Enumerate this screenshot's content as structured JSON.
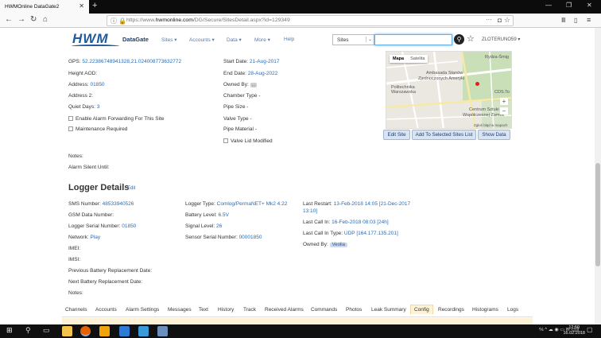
{
  "browser": {
    "tab_title": "HWMOnline DataGate2",
    "url_prefix": "https://www.",
    "url_domain": "hwmonline.com",
    "url_path": "/DG/Secure/SitesDetail.aspx?id=129349"
  },
  "header": {
    "logo": "HWM",
    "brand": "DataGate",
    "menu": [
      "Sites ▾",
      "Accounts ▾",
      "Data ▾",
      "More ▾",
      "Help"
    ],
    "sites_select": "Sites",
    "user": "ZLOTERUNO59 ▾"
  },
  "site": {
    "gps_label": "GPS:",
    "gps_value": "52.22386748941328,21.024008773632772",
    "height_label": "Height AOD:",
    "address_label": "Address:",
    "address_value": "01850",
    "address2_label": "Address 2:",
    "quiet_days_label": "Quiet Days:",
    "quiet_days_value": "3",
    "alarm_forwarding_label": "Enable Alarm Forwarding For This Site",
    "maintenance_label": "Maintenance Required",
    "start_date_label": "Start Date:",
    "start_date_value": "21-Aug-2017",
    "end_date_label": "End Date:",
    "end_date_value": "28-Aug-2022",
    "owned_by_label": "Owned By:",
    "owned_by_value": "...",
    "chamber_type_label": "Chamber Type -",
    "pipe_size_label": "Pipe Size -",
    "valve_type_label": "Valve Type -",
    "pipe_material_label": "Pipe Material -",
    "valve_lid_label": "Valve Lid Modified",
    "notes_label": "Notes:",
    "alarm_silent_label": "Alarm Silent Until:"
  },
  "map": {
    "tab_map": "Mapa",
    "tab_satellite": "Satelita",
    "labels": [
      "Rydza-Śmig",
      "Ambasada Stanów",
      "Zjednoczonych Ameryki",
      "Politechnika",
      "Warszawska",
      "Centrum Sztuki",
      "Współczesnej Zamek",
      "CDS.To",
      "Zgłoś błąd w mapach"
    ],
    "zoom_in": "+",
    "zoom_out": "−"
  },
  "map_buttons": {
    "edit_site": "Edit Site",
    "add_to_selected": "Add To Selected Sites List",
    "show_data": "Show Data"
  },
  "logger": {
    "title": "Logger Details",
    "edit": "Edit",
    "sms_label": "SMS Number:",
    "sms_value": "48533940526",
    "gsm_label": "GSM Data Number:",
    "serial_label": "Logger Serial Number:",
    "serial_value": "01850",
    "network_label": "Network:",
    "network_value": "Play",
    "imei_label": "IMEI:",
    "imsi_label": "IMSI:",
    "prev_battery_label": "Previous Battery Replacement Date:",
    "next_battery_label": "Next Battery Replacement Date:",
    "notes_label": "Notes:",
    "type_label": "Logger Type:",
    "type_value": "Comlog/PermaNET+ Mk2 4.22",
    "battery_label": "Battery Level:",
    "battery_value": "6.5V",
    "signal_label": "Signal Level:",
    "signal_value": "26",
    "sensor_label": "Sensor Serial Number:",
    "sensor_value": "00001850",
    "last_restart_label": "Last Restart:",
    "last_restart_value": "13-Feb-2018 14:05 [21-Dec-2017",
    "last_restart_value2": "13:10]",
    "last_call_in_label": "Last Call In:",
    "last_call_in_value": "16-Feb-2018 08:03 [24h]",
    "last_call_type_label": "Last Call In Type:",
    "last_call_type_value": "UDP [164.177.135.201]",
    "owned_by_label": "Owned By:",
    "owned_by_value": "Veolia"
  },
  "tabs": [
    "Channels",
    "Accounts",
    "Alarm Settings",
    "Messages",
    "Text",
    "History",
    "Track",
    "Received Alarms",
    "Commands",
    "Photos",
    "Leak Summary",
    "Config",
    "Recordings",
    "Histograms",
    "Logs"
  ],
  "taskbar": {
    "time": "12:50",
    "date": "16.02.2018"
  }
}
